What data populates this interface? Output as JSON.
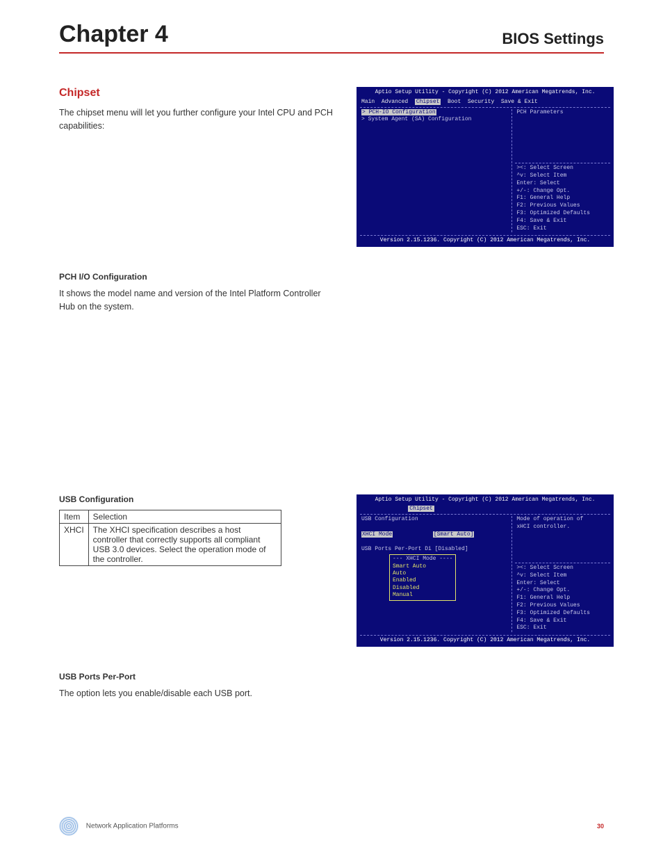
{
  "header": {
    "chapter": "Chapter 4",
    "section": "BIOS Settings"
  },
  "chipset": {
    "heading": "Chipset",
    "intro": "The chipset menu will let you further configure your Intel CPU and PCH capabilities:"
  },
  "bios1": {
    "title": "Aptio Setup Utility - Copyright (C) 2012 American Megatrends, Inc.",
    "menu": [
      "Main",
      "Advanced",
      "Chipset",
      "Boot",
      "Security",
      "Save & Exit"
    ],
    "active_menu": "Chipset",
    "main_items": [
      "> PCH-IO Configuration",
      "> System Agent (SA) Configuration"
    ],
    "help_top": "PCH Parameters",
    "help_keys": [
      "><: Select Screen",
      "^v: Select Item",
      "Enter: Select",
      "+/-: Change Opt.",
      "F1: General Help",
      "F2: Previous Values",
      "F3: Optimized Defaults",
      "F4: Save & Exit",
      "ESC: Exit"
    ],
    "footer": "Version 2.15.1236. Copyright (C) 2012 American Megatrends, Inc."
  },
  "pch": {
    "heading": "PCH I/O Configuration",
    "text": "It shows the model name and version of the  Intel Platform Controller Hub on the system."
  },
  "usb": {
    "heading": "USB Configuration",
    "table": {
      "headers": [
        "Item",
        "Selection"
      ],
      "row": {
        "item": "XHCI",
        "selection": "The XHCI specification describes a host controller that correctly supports all compliant USB 3.0 devices. Select the operation mode of the controller."
      }
    }
  },
  "bios2": {
    "title": "Aptio Setup Utility - Copyright (C) 2012 American Megatrends, Inc.",
    "active_menu": "Chipset",
    "main_lines": {
      "l1": "USB Configuration",
      "l2_label": "XHCI Mode",
      "l2_value": "[Smart Auto]",
      "l3_label": "USB Ports Per-Port Di",
      "l3_value": "[Disabled]"
    },
    "popup_title": "--- XHCI Mode ----",
    "popup_items": [
      "Smart Auto",
      "Auto",
      "Enabled",
      "Disabled",
      "Manual"
    ],
    "help_top": "Mode of operation of\nxHCI controller.",
    "help_keys": [
      "><: Select Screen",
      "^v: Select Item",
      "Enter: Select",
      "+/-: Change Opt.",
      "F1: General Help",
      "F2: Previous Values",
      "F3: Optimized Defaults",
      "F4: Save & Exit",
      "ESC: Exit"
    ],
    "footer": "Version 2.15.1236. Copyright (C) 2012 American Megatrends, Inc."
  },
  "usb_ports": {
    "heading": "USB Ports Per-Port",
    "text": "The option lets you enable/disable each USB port."
  },
  "footer": {
    "text": "Network Application Platforms",
    "page": "30"
  }
}
